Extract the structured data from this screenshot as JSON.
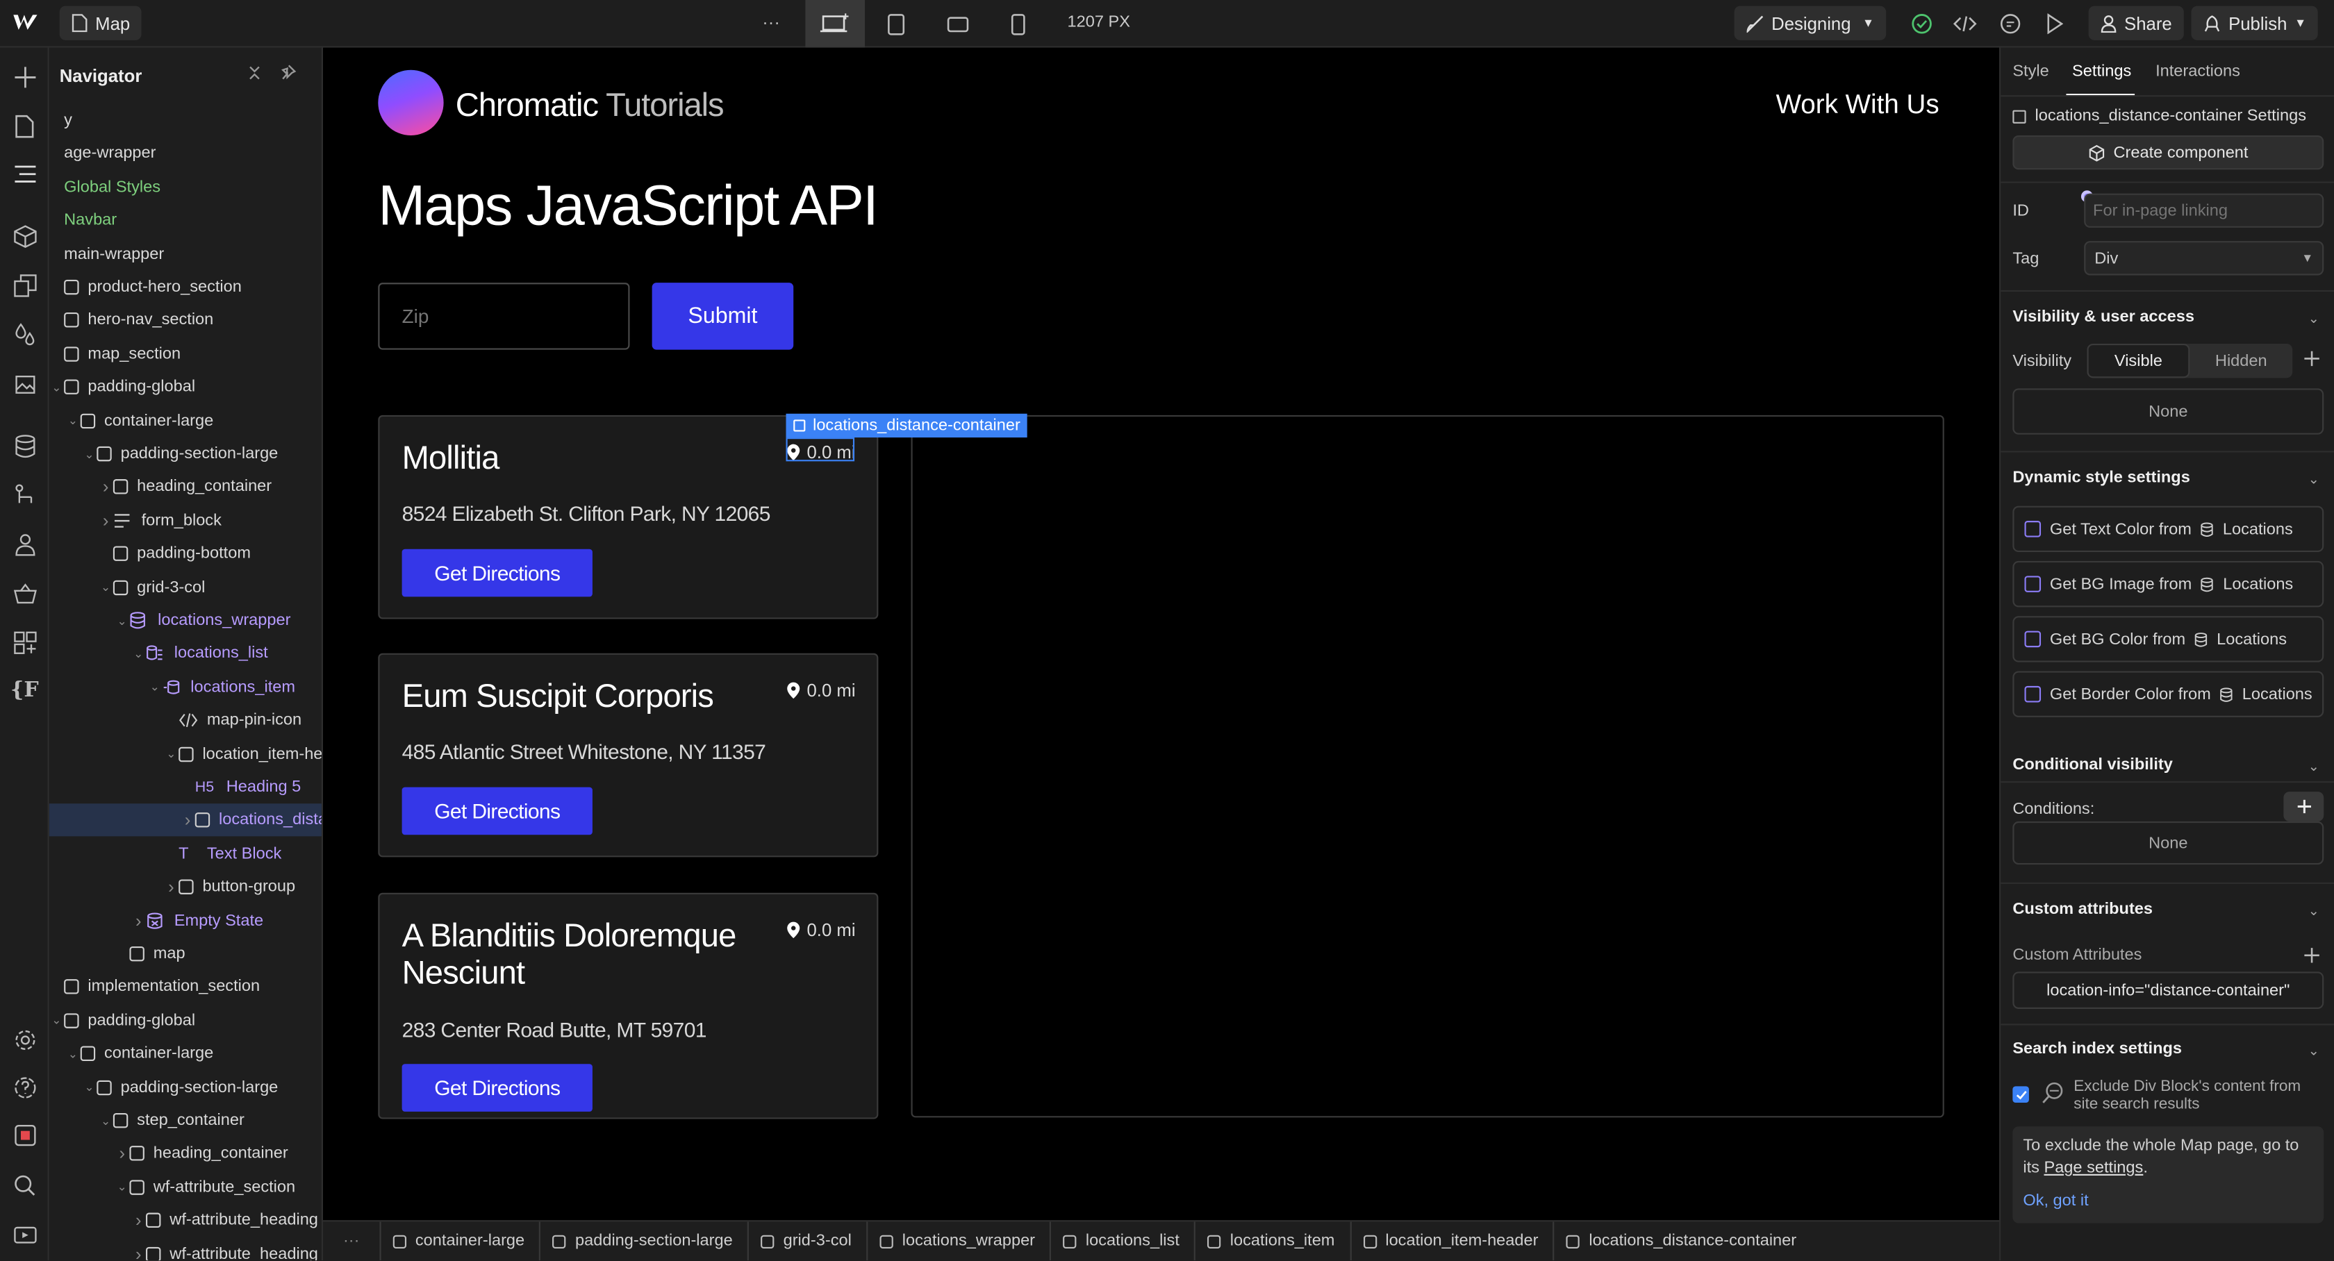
{
  "topbar": {
    "page_name": "Map",
    "more": "···",
    "width_readout": "1207 PX",
    "mode": "Designing",
    "share": "Share",
    "publish": "Publish"
  },
  "navigator": {
    "title": "Navigator",
    "rows": [
      {
        "label": "y",
        "depth": 0,
        "chev": "",
        "icon": "none",
        "color": "default"
      },
      {
        "label": "age-wrapper",
        "depth": 0,
        "chev": "",
        "icon": "none",
        "color": "default"
      },
      {
        "label": "Global Styles",
        "depth": 0,
        "chev": "",
        "icon": "none",
        "color": "green"
      },
      {
        "label": "Navbar",
        "depth": 0,
        "chev": "",
        "icon": "none",
        "color": "green"
      },
      {
        "label": "main-wrapper",
        "depth": 0,
        "chev": "",
        "icon": "none",
        "color": "default"
      },
      {
        "label": "product-hero_section",
        "depth": 0,
        "chev": "",
        "icon": "box",
        "color": "default"
      },
      {
        "label": "hero-nav_section",
        "depth": 0,
        "chev": "",
        "icon": "box",
        "color": "default"
      },
      {
        "label": "map_section",
        "depth": 0,
        "chev": "",
        "icon": "box",
        "color": "default"
      },
      {
        "label": "padding-global",
        "depth": 0,
        "chev": "down",
        "icon": "box",
        "color": "default"
      },
      {
        "label": "container-large",
        "depth": 1,
        "chev": "down",
        "icon": "box",
        "color": "default"
      },
      {
        "label": "padding-section-large",
        "depth": 2,
        "chev": "down",
        "icon": "box",
        "color": "default"
      },
      {
        "label": "heading_container",
        "depth": 3,
        "chev": "right",
        "icon": "box",
        "color": "default"
      },
      {
        "label": "form_block",
        "depth": 3,
        "chev": "right",
        "icon": "lines",
        "color": "default"
      },
      {
        "label": "padding-bottom",
        "depth": 3,
        "chev": "",
        "icon": "box",
        "color": "default"
      },
      {
        "label": "grid-3-col",
        "depth": 3,
        "chev": "down",
        "icon": "box",
        "color": "default"
      },
      {
        "label": "locations_wrapper",
        "depth": 4,
        "chev": "down",
        "icon": "db",
        "color": "purple"
      },
      {
        "label": "locations_list",
        "depth": 5,
        "chev": "down",
        "icon": "list",
        "color": "purple"
      },
      {
        "label": "locations_item",
        "depth": 6,
        "chev": "down",
        "icon": "item",
        "color": "purple"
      },
      {
        "label": "map-pin-icon",
        "depth": 7,
        "chev": "",
        "icon": "code",
        "color": "default"
      },
      {
        "label": "location_item-header",
        "depth": 7,
        "chev": "down",
        "icon": "box",
        "color": "default"
      },
      {
        "label": "Heading 5",
        "depth": 8,
        "chev": "",
        "icon": "h5",
        "color": "purple"
      },
      {
        "label": "locations_distance-container",
        "depth": 8,
        "chev": "right",
        "icon": "box",
        "color": "purple",
        "selected": true
      },
      {
        "label": "Text Block",
        "depth": 7,
        "chev": "",
        "icon": "t",
        "color": "purple"
      },
      {
        "label": "button-group",
        "depth": 7,
        "chev": "right",
        "icon": "box",
        "color": "default"
      },
      {
        "label": "Empty State",
        "depth": 5,
        "chev": "right",
        "icon": "empty",
        "color": "purple"
      },
      {
        "label": "map",
        "depth": 4,
        "chev": "",
        "icon": "box",
        "color": "default"
      },
      {
        "label": "implementation_section",
        "depth": 0,
        "chev": "",
        "icon": "box",
        "color": "default"
      },
      {
        "label": "padding-global",
        "depth": 0,
        "chev": "down",
        "icon": "box",
        "color": "default"
      },
      {
        "label": "container-large",
        "depth": 1,
        "chev": "down",
        "icon": "box",
        "color": "default"
      },
      {
        "label": "padding-section-large",
        "depth": 2,
        "chev": "down",
        "icon": "box",
        "color": "default"
      },
      {
        "label": "step_container",
        "depth": 3,
        "chev": "down",
        "icon": "box",
        "color": "default"
      },
      {
        "label": "heading_container",
        "depth": 4,
        "chev": "right",
        "icon": "box",
        "color": "default"
      },
      {
        "label": "wf-attribute_section",
        "depth": 4,
        "chev": "down",
        "icon": "box",
        "color": "default"
      },
      {
        "label": "wf-attribute_heading",
        "depth": 5,
        "chev": "right",
        "icon": "box",
        "color": "default"
      },
      {
        "label": "wf-attribute_heading",
        "depth": 5,
        "chev": "right",
        "icon": "box",
        "color": "default"
      }
    ]
  },
  "canvas": {
    "brand_main": "Chromatic",
    "brand_sub": "Tutorials",
    "nav_link": "Work With Us",
    "heading": "Maps JavaScript API",
    "zip_placeholder": "Zip",
    "submit": "Submit",
    "selection_label": "locations_distance-container",
    "locations": [
      {
        "name": "Mollitia",
        "distance": "0.0 mi",
        "address": "8524 Elizabeth St. Clifton Park, NY 12065",
        "button": "Get Directions"
      },
      {
        "name": "Eum Suscipit Corporis",
        "distance": "0.0 mi",
        "address": "485 Atlantic Street Whitestone, NY 11357",
        "button": "Get Directions"
      },
      {
        "name": "A Blanditiis Doloremque Nesciunt",
        "distance": "0.0 mi",
        "address": "283 Center Road Butte, MT 59701",
        "button": "Get Directions"
      }
    ]
  },
  "breadcrumbs": [
    "container-large",
    "padding-section-large",
    "grid-3-col",
    "locations_wrapper",
    "locations_list",
    "locations_item",
    "location_item-header",
    "locations_distance-container"
  ],
  "breadcrumb_more": "···",
  "panel": {
    "tabs": [
      "Style",
      "Settings",
      "Interactions"
    ],
    "element_settings": "locations_distance-container Settings",
    "create_component": "Create component",
    "id_label": "ID",
    "id_placeholder": "For in-page linking",
    "tag_label": "Tag",
    "tag_value": "Div",
    "visibility_title": "Visibility & user access",
    "visibility_label": "Visibility",
    "visible": "Visible",
    "hidden": "Hidden",
    "visibility_none": "None",
    "dynamic_title": "Dynamic style settings",
    "dynamic": [
      {
        "label": "Get Text Color from",
        "source": "Locations"
      },
      {
        "label": "Get BG Image from",
        "source": "Locations"
      },
      {
        "label": "Get BG Color from",
        "source": "Locations"
      },
      {
        "label": "Get Border Color from",
        "source": "Locations"
      }
    ],
    "conditional_title": "Conditional visibility",
    "conditions_label": "Conditions:",
    "conditions_none": "None",
    "custom_title": "Custom attributes",
    "custom_label": "Custom Attributes",
    "custom_value": "location-info=\"distance-container\"",
    "search_title": "Search index settings",
    "search_text": "Exclude Div Block's content from site search results",
    "note_text": "To exclude the whole Map page, go to its",
    "note_link": "Page settings",
    "note_ok": "Ok, got it"
  },
  "colors": {
    "accent_blue": "#3537e8",
    "selection_blue": "#3b82f6",
    "navigator_purple": "#b79cff",
    "global_green": "#7ed07e"
  }
}
